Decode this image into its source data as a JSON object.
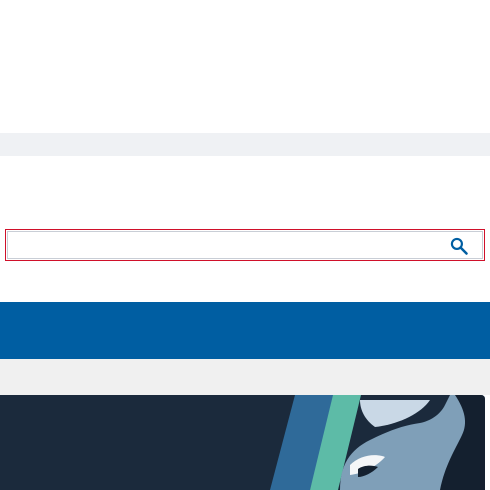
{
  "search": {
    "value": "",
    "placeholder": "",
    "icon": "search-icon",
    "accent_color": "#005ea2",
    "focus_outline_color": "#d0102a"
  },
  "colors": {
    "gray_band": "#eff1f4",
    "nav": "#005ea2",
    "strip": "#f0f0f0",
    "hero_bg": "#1b2a3c",
    "hero_stripe_blue": "#2f6a99",
    "hero_stripe_teal": "#5dbba7",
    "hero_figure": "#7f9fb8"
  },
  "hero": {
    "image": "hero-illustration-profile"
  }
}
